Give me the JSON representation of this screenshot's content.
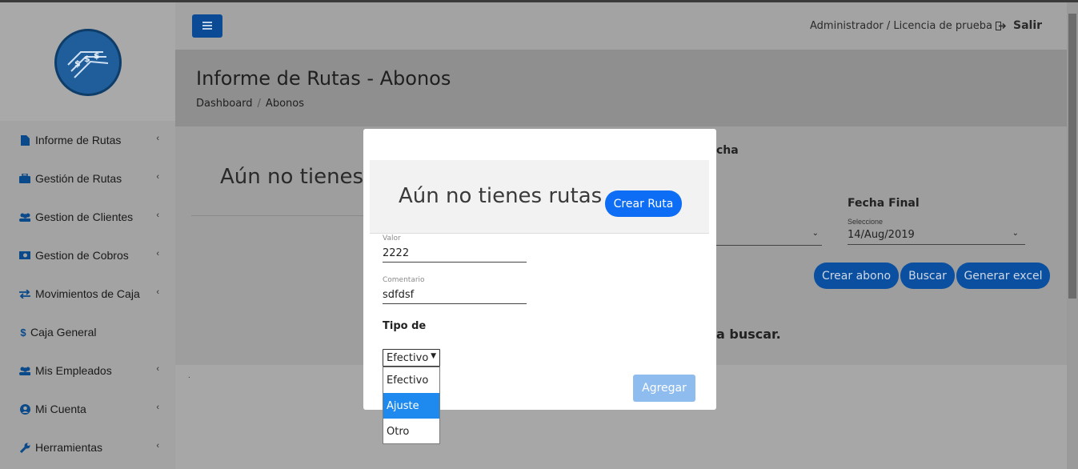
{
  "header": {
    "user_text": "Administrador / Licencia de prueba",
    "logout_label": "Salir"
  },
  "sidebar": {
    "items": [
      {
        "label": "Informe de Rutas",
        "icon": "file-icon",
        "has_chevron": true
      },
      {
        "label": "Gestión de Rutas",
        "icon": "briefcase-icon",
        "has_chevron": true
      },
      {
        "label": "Gestion de Clientes",
        "icon": "users-icon",
        "has_chevron": true
      },
      {
        "label": "Gestion de Cobros",
        "icon": "money-icon",
        "has_chevron": true
      },
      {
        "label": "Movimientos de Caja",
        "icon": "exchange-icon",
        "has_chevron": true
      },
      {
        "label": "Caja General",
        "icon": "dollar-icon",
        "has_chevron": false
      },
      {
        "label": "Mis Empleados",
        "icon": "users-icon",
        "has_chevron": true
      },
      {
        "label": "Mi Cuenta",
        "icon": "user-circle-icon",
        "has_chevron": true
      },
      {
        "label": "Herramientas",
        "icon": "wrench-icon",
        "has_chevron": true
      }
    ]
  },
  "page": {
    "title": "Informe de Rutas - Abonos",
    "breadcrumb": [
      "Dashboard",
      "Abonos"
    ]
  },
  "background": {
    "empty_text": "Aún no tienes r",
    "fecha_fragment": "cha",
    "fecha_final_label": "Fecha Final",
    "select_hint": "Seleccione",
    "fecha_final_value": "14/Aug/2019",
    "buscar_fragment": "a buscar.",
    "buttons": [
      "Crear abono",
      "Buscar",
      "Generar excel"
    ],
    "dot": "."
  },
  "modal": {
    "empty_text": "Aún no tienes rutas",
    "crear_ruta_label": "Crear Ruta",
    "valor_label": "Valor",
    "valor_value": "2222",
    "comentario_label": "Comentario",
    "comentario_value": "sdfdsf",
    "tipo_label": "Tipo de",
    "tipo_selected": "Efectivo",
    "tipo_options": [
      "Efectivo",
      "Ajuste",
      "Otro"
    ],
    "highlighted_option": "Ajuste",
    "agregar_label": "Agregar"
  },
  "colors": {
    "primary": "#0d6ef5",
    "highlight": "#1e8af0",
    "disabled_button": "#8fbcef"
  }
}
